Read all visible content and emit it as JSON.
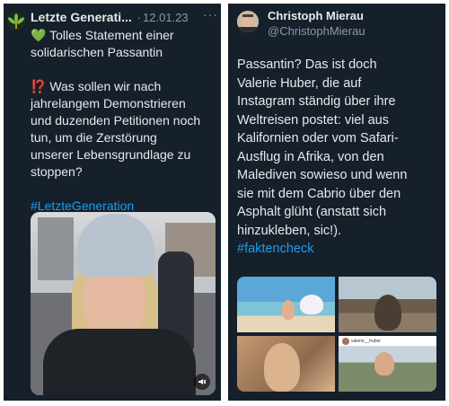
{
  "left_tweet": {
    "author": "Letzte Generati...",
    "separator": "·",
    "date": "12.01.23",
    "more": "···",
    "lines": [
      "💚 Tolles Statement einer",
      "solidarischen Passantin",
      "",
      "⁉️ Was sollen wir nach",
      "jahrelangem Demonstrieren",
      "und duzenden Petitionen noch",
      "tun, um die Zerstörung",
      "unserer Lebensgrundlage zu",
      "stoppen?",
      ""
    ],
    "hashtag": "#LetzteGeneration",
    "avatar_icon": "sunflower-icon",
    "media_icon": "volume-icon"
  },
  "right_tweet": {
    "author": "Christoph Mierau",
    "handle": "@ChristophMierau",
    "text_lines": [
      "Passantin? Das ist doch",
      "Valerie Huber, die auf",
      "Instagram ständig über ihre",
      "Weltreisen postet: viel aus",
      "Kalifornien oder vom Safari-",
      "Ausflug in Afrika, von den",
      "Malediven sowieso und wenn",
      "sie mit dem Cabrio über den",
      "Asphalt glüht (anstatt sich",
      "hinzukleben, sic!)."
    ],
    "hashtag": "#faktencheck",
    "photo4_caption": "valerie__huber"
  },
  "colors": {
    "background": "#15202b",
    "text": "#e7e9ea",
    "muted": "#8b98a5",
    "link": "#1d9bf0"
  }
}
